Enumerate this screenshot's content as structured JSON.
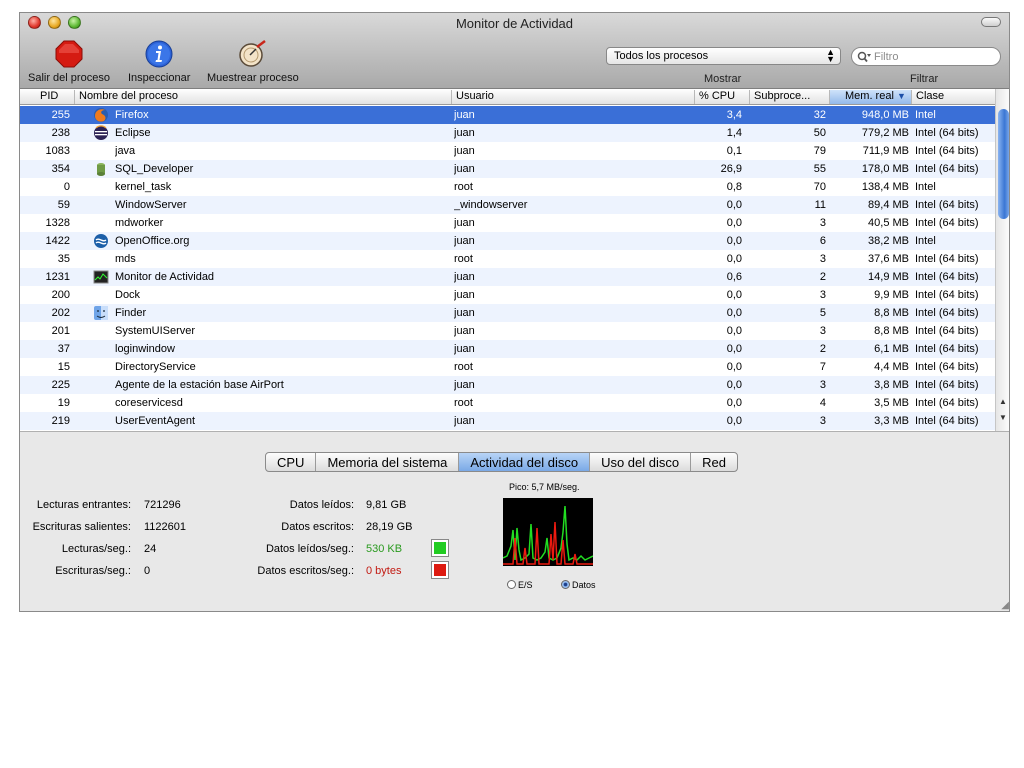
{
  "window": {
    "title": "Monitor de Actividad"
  },
  "toolbar": {
    "quit_label": "Salir del proceso",
    "inspect_label": "Inspeccionar",
    "sample_label": "Muestrear proceso",
    "show_select_value": "Todos los procesos",
    "show_label": "Mostrar",
    "filter_placeholder": "Filtro",
    "filter_label": "Filtrar"
  },
  "table": {
    "columns": [
      "PID",
      "Nombre del proceso",
      "Usuario",
      "% CPU",
      "Subproce...",
      "Mem. real",
      "Clase"
    ],
    "sort_indicator": "▼",
    "rows": [
      {
        "pid": "255",
        "name": "Firefox",
        "user": "juan",
        "cpu": "3,4",
        "threads": "32",
        "mem": "948,0 MB",
        "class": "Intel",
        "icon": "firefox-icon"
      },
      {
        "pid": "238",
        "name": "Eclipse",
        "user": "juan",
        "cpu": "1,4",
        "threads": "50",
        "mem": "779,2 MB",
        "class": "Intel (64 bits)",
        "icon": "eclipse-icon"
      },
      {
        "pid": "1083",
        "name": "java",
        "user": "juan",
        "cpu": "0,1",
        "threads": "79",
        "mem": "711,9 MB",
        "class": "Intel (64 bits)",
        "icon": ""
      },
      {
        "pid": "354",
        "name": "SQL_Developer",
        "user": "juan",
        "cpu": "26,9",
        "threads": "55",
        "mem": "178,0 MB",
        "class": "Intel (64 bits)",
        "icon": "sql-developer-icon"
      },
      {
        "pid": "0",
        "name": "kernel_task",
        "user": "root",
        "cpu": "0,8",
        "threads": "70",
        "mem": "138,4 MB",
        "class": "Intel",
        "icon": ""
      },
      {
        "pid": "59",
        "name": "WindowServer",
        "user": "_windowserver",
        "cpu": "0,0",
        "threads": "11",
        "mem": "89,4 MB",
        "class": "Intel (64 bits)",
        "icon": ""
      },
      {
        "pid": "1328",
        "name": "mdworker",
        "user": "juan",
        "cpu": "0,0",
        "threads": "3",
        "mem": "40,5 MB",
        "class": "Intel (64 bits)",
        "icon": ""
      },
      {
        "pid": "1422",
        "name": "OpenOffice.org",
        "user": "juan",
        "cpu": "0,0",
        "threads": "6",
        "mem": "38,2 MB",
        "class": "Intel",
        "icon": "openoffice-icon"
      },
      {
        "pid": "35",
        "name": "mds",
        "user": "root",
        "cpu": "0,0",
        "threads": "3",
        "mem": "37,6 MB",
        "class": "Intel (64 bits)",
        "icon": ""
      },
      {
        "pid": "1231",
        "name": "Monitor de Actividad",
        "user": "juan",
        "cpu": "0,6",
        "threads": "2",
        "mem": "14,9 MB",
        "class": "Intel (64 bits)",
        "icon": "activity-monitor-icon"
      },
      {
        "pid": "200",
        "name": "Dock",
        "user": "juan",
        "cpu": "0,0",
        "threads": "3",
        "mem": "9,9 MB",
        "class": "Intel (64 bits)",
        "icon": ""
      },
      {
        "pid": "202",
        "name": "Finder",
        "user": "juan",
        "cpu": "0,0",
        "threads": "5",
        "mem": "8,8 MB",
        "class": "Intel (64 bits)",
        "icon": "finder-icon"
      },
      {
        "pid": "201",
        "name": "SystemUIServer",
        "user": "juan",
        "cpu": "0,0",
        "threads": "3",
        "mem": "8,8 MB",
        "class": "Intel (64 bits)",
        "icon": ""
      },
      {
        "pid": "37",
        "name": "loginwindow",
        "user": "juan",
        "cpu": "0,0",
        "threads": "2",
        "mem": "6,1 MB",
        "class": "Intel (64 bits)",
        "icon": ""
      },
      {
        "pid": "15",
        "name": "DirectoryService",
        "user": "root",
        "cpu": "0,0",
        "threads": "7",
        "mem": "4,4 MB",
        "class": "Intel (64 bits)",
        "icon": ""
      },
      {
        "pid": "225",
        "name": "Agente de la estación base AirPort",
        "user": "juan",
        "cpu": "0,0",
        "threads": "3",
        "mem": "3,8 MB",
        "class": "Intel (64 bits)",
        "icon": ""
      },
      {
        "pid": "19",
        "name": "coreservicesd",
        "user": "root",
        "cpu": "0,0",
        "threads": "4",
        "mem": "3,5 MB",
        "class": "Intel (64 bits)",
        "icon": ""
      },
      {
        "pid": "219",
        "name": "UserEventAgent",
        "user": "juan",
        "cpu": "0,0",
        "threads": "3",
        "mem": "3,3 MB",
        "class": "Intel (64 bits)",
        "icon": ""
      }
    ]
  },
  "tabs": [
    "CPU",
    "Memoria del sistema",
    "Actividad del disco",
    "Uso del disco",
    "Red"
  ],
  "disk": {
    "reads_in_label": "Lecturas entrantes:",
    "reads_in_value": "721296",
    "writes_out_label": "Escrituras salientes:",
    "writes_out_value": "1122601",
    "reads_sec_label": "Lecturas/seg.:",
    "reads_sec_value": "24",
    "writes_sec_label": "Escrituras/seg.:",
    "writes_sec_value": "0",
    "data_read_label": "Datos leídos:",
    "data_read_value": "9,81 GB",
    "data_written_label": "Datos escritos:",
    "data_written_value": "28,19 GB",
    "data_read_sec_label": "Datos leídos/seg.:",
    "data_read_sec_value": "530 KB",
    "data_written_sec_label": "Datos escritos/seg.:",
    "data_written_sec_value": "0 bytes",
    "peak_label": "Pico: 5,7 MB/seg.",
    "radio_io_label": "E/S",
    "radio_data_label": "Datos",
    "read_color": "#22cc22",
    "write_color": "#dd1a10"
  }
}
